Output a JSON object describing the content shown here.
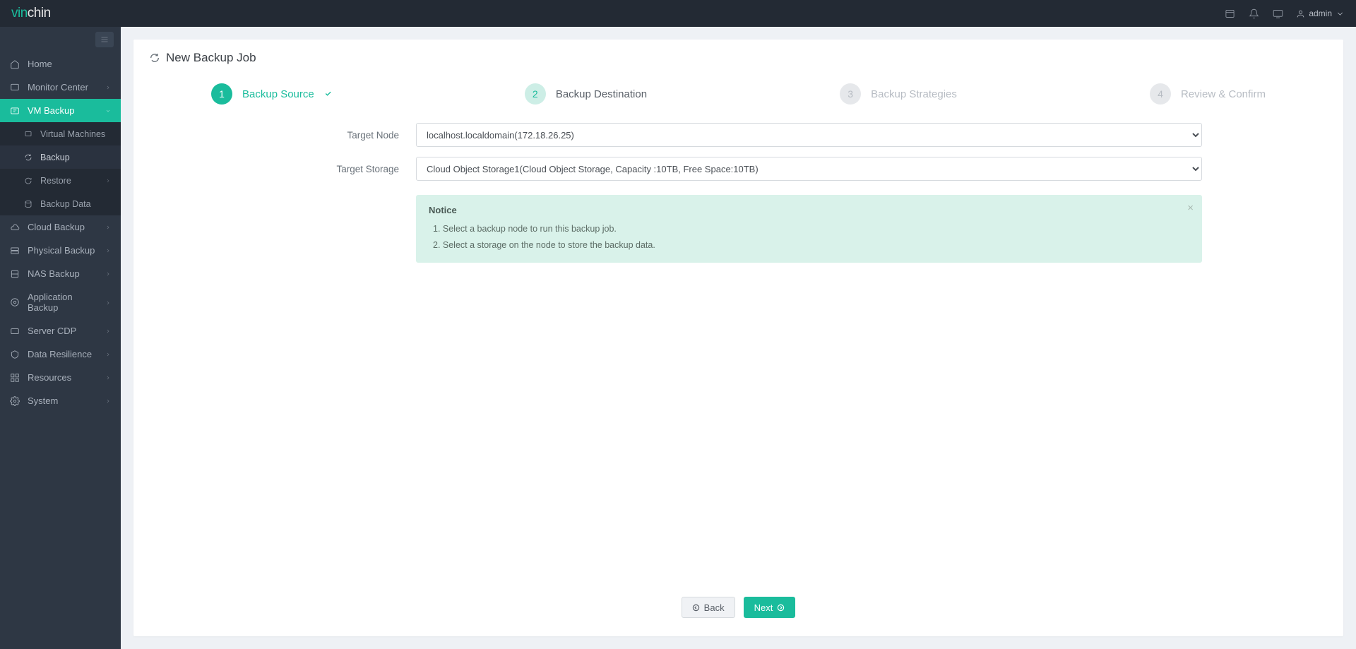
{
  "brand": {
    "part1": "vin",
    "part2": "chin"
  },
  "user": {
    "name": "admin"
  },
  "sidebar": {
    "items": [
      {
        "label": "Home"
      },
      {
        "label": "Monitor Center"
      },
      {
        "label": "VM Backup"
      },
      {
        "label": "Cloud Backup"
      },
      {
        "label": "Physical Backup"
      },
      {
        "label": "NAS Backup"
      },
      {
        "label": "Application Backup"
      },
      {
        "label": "Server CDP"
      },
      {
        "label": "Data Resilience"
      },
      {
        "label": "Resources"
      },
      {
        "label": "System"
      }
    ],
    "vm_sub": [
      {
        "label": "Virtual Machines"
      },
      {
        "label": "Backup"
      },
      {
        "label": "Restore"
      },
      {
        "label": "Backup Data"
      }
    ]
  },
  "page": {
    "title": "New Backup Job"
  },
  "steps": [
    {
      "num": "1",
      "label": "Backup Source"
    },
    {
      "num": "2",
      "label": "Backup Destination"
    },
    {
      "num": "3",
      "label": "Backup Strategies"
    },
    {
      "num": "4",
      "label": "Review & Confirm"
    }
  ],
  "form": {
    "target_node_label": "Target Node",
    "target_node_value": "localhost.localdomain(172.18.26.25)",
    "target_storage_label": "Target Storage",
    "target_storage_value": "Cloud Object Storage1(Cloud Object Storage, Capacity :10TB, Free Space:10TB)"
  },
  "notice": {
    "title": "Notice",
    "line1": "1. Select a backup node to run this backup job.",
    "line2": "2. Select a storage on the node to store the backup data."
  },
  "buttons": {
    "back": "Back",
    "next": "Next"
  }
}
